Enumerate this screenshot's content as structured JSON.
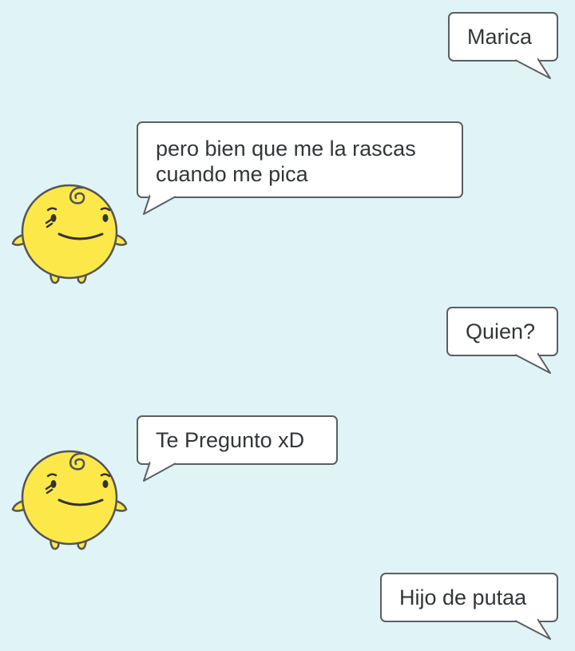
{
  "chat": {
    "messages": [
      {
        "id": "msg-1",
        "sender": "user",
        "text": "Marica"
      },
      {
        "id": "msg-2",
        "sender": "bot",
        "text": "pero bien que me la rascas\ncuando me pica"
      },
      {
        "id": "msg-3",
        "sender": "user",
        "text": "Quien?"
      },
      {
        "id": "msg-4",
        "sender": "bot",
        "text": "Te Pregunto xD"
      },
      {
        "id": "msg-5",
        "sender": "user",
        "text": "Hijo de putaa"
      }
    ]
  },
  "theme": {
    "background": "#e0f3f6",
    "bubble_fill": "#ffffff",
    "bubble_border": "#5a5f63",
    "text_color": "#333638",
    "avatar_fill": "#fde84a",
    "avatar_outline": "#555555"
  },
  "icons": {
    "bot_avatar": "yellow-blob-mascot-icon"
  }
}
